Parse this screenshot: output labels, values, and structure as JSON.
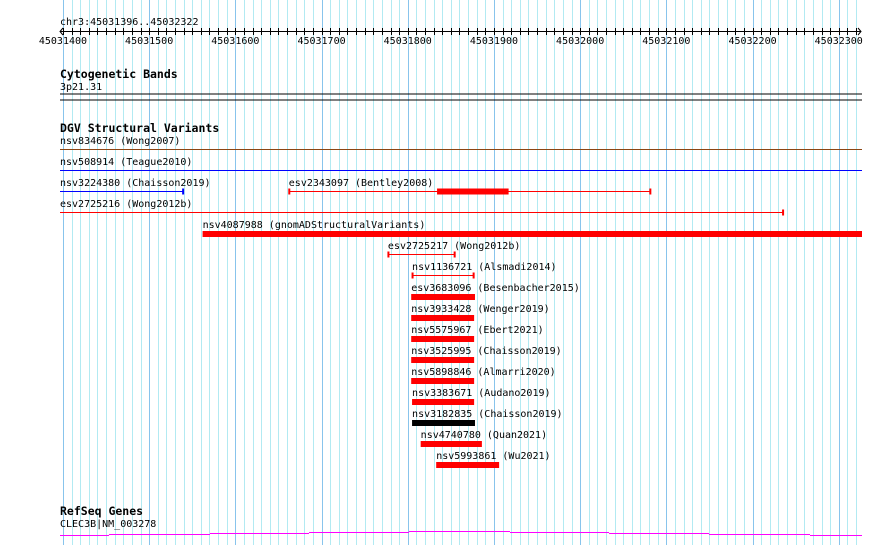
{
  "position": "chr3:45031396..45032322",
  "view": {
    "start": 45031396,
    "end": 45032322
  },
  "ruler": {
    "labels": [
      "45031400",
      "45031500",
      "45031600",
      "45031700",
      "45031800",
      "45031900",
      "45032000",
      "45032100",
      "45032200",
      "45032300"
    ]
  },
  "cytoband": {
    "title": "Cytogenetic Bands",
    "band": "3p21.31"
  },
  "dgv": {
    "title": "DGV Structural Variants",
    "variants": [
      {
        "label": "nsv834676 (Wong2007)",
        "start": 45031300,
        "end": 45032400,
        "color": "#8b4513",
        "style": "line",
        "row": 0
      },
      {
        "label": "nsv508914 (Teague2010)",
        "start": 45031300,
        "end": 45032400,
        "color": "#0000ff",
        "style": "line",
        "row": 1
      },
      {
        "label": "nsv3224380 (Chaisson2019)",
        "start": 45031300,
        "end": 45031540,
        "color": "#0000ff",
        "style": "line",
        "row": 2
      },
      {
        "label": "esv2343097 (Bentley2008)",
        "start": 45031662,
        "end": 45032082,
        "thickStart": 45031834,
        "thickEnd": 45031917,
        "color": "#ff0000",
        "style": "line",
        "row": 2
      },
      {
        "label": "esv2725216 (Wong2012b)",
        "start": 45031300,
        "end": 45032236,
        "color": "#ff0000",
        "style": "line",
        "row": 3
      },
      {
        "label": "nsv4087988 (gnomADStructuralVariants)",
        "start": 45031562,
        "end": 45032400,
        "color": "#ff0000",
        "style": "thick",
        "row": 4
      },
      {
        "label": "esv2725217 (Wong2012b)",
        "start": 45031777,
        "end": 45031855,
        "color": "#ff0000",
        "style": "line",
        "row": 5
      },
      {
        "label": "nsv1136721 (Alsmadi2014)",
        "start": 45031805,
        "end": 45031877,
        "color": "#ff0000",
        "style": "line",
        "row": 6
      },
      {
        "label": "esv3683096 (Besenbacher2015)",
        "start": 45031804,
        "end": 45031878,
        "color": "#ff0000",
        "style": "thick",
        "row": 7
      },
      {
        "label": "nsv3933428 (Wenger2019)",
        "start": 45031804,
        "end": 45031877,
        "color": "#ff0000",
        "style": "thick",
        "row": 8
      },
      {
        "label": "nsv5575967 (Ebert2021)",
        "start": 45031804,
        "end": 45031877,
        "color": "#ff0000",
        "style": "thick",
        "row": 9
      },
      {
        "label": "nsv3525995 (Chaisson2019)",
        "start": 45031804,
        "end": 45031877,
        "color": "#ff0000",
        "style": "thick",
        "row": 10
      },
      {
        "label": "nsv5898846 (Almarri2020)",
        "start": 45031804,
        "end": 45031877,
        "color": "#ff0000",
        "style": "thick",
        "row": 11
      },
      {
        "label": "nsv3383671 (Audano2019)",
        "start": 45031805,
        "end": 45031877,
        "color": "#ff0000",
        "style": "thick",
        "row": 12
      },
      {
        "label": "nsv3182835 (Chaisson2019)",
        "start": 45031805,
        "end": 45031878,
        "color": "#000000",
        "style": "thick",
        "row": 13
      },
      {
        "label": "nsv4740780 (Quan2021)",
        "start": 45031815,
        "end": 45031886,
        "color": "#ff0000",
        "style": "thick",
        "row": 14
      },
      {
        "label": "nsv5993861 (Wu2021)",
        "start": 45031833,
        "end": 45031906,
        "color": "#ff0000",
        "style": "thick",
        "row": 15
      }
    ]
  },
  "refseq": {
    "title": "RefSeq Genes",
    "gene": "CLEC3B|NM_003278",
    "color": "#ff00ff"
  }
}
